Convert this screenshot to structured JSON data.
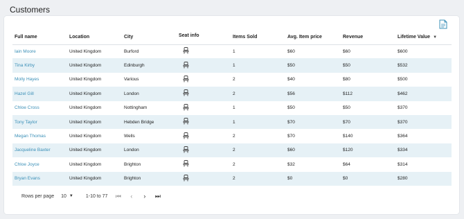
{
  "page": {
    "title": "Customers"
  },
  "icons": {
    "export": "document-export-icon",
    "seat": "seat-icon",
    "sort": "sort-desc-icon"
  },
  "colors": {
    "link": "#3a8fb7",
    "stripe": "#e6f1f6"
  },
  "table": {
    "columns": [
      "Full name",
      "Location",
      "City",
      "Seat info",
      "Items Sold",
      "Avg. Item price",
      "Revenue",
      "Lifetime Value"
    ],
    "sort": {
      "column": "Lifetime Value",
      "direction": "desc"
    },
    "rows": [
      {
        "name": "Iain Moore",
        "location": "United Kingdom",
        "city": "Burford",
        "items": "1",
        "avg": "$60",
        "revenue": "$60",
        "ltv": "$600"
      },
      {
        "name": "Tina Kirby",
        "location": "United Kingdom",
        "city": "Edinburgh",
        "items": "1",
        "avg": "$50",
        "revenue": "$50",
        "ltv": "$532"
      },
      {
        "name": "Molly Hayes",
        "location": "United Kingdom",
        "city": "Various",
        "items": "2",
        "avg": "$40",
        "revenue": "$80",
        "ltv": "$500"
      },
      {
        "name": "Hazel Gill",
        "location": "United Kingdom",
        "city": "London",
        "items": "2",
        "avg": "$56",
        "revenue": "$112",
        "ltv": "$462"
      },
      {
        "name": "Chloe Cross",
        "location": "United Kingdom",
        "city": "Nottingham",
        "items": "1",
        "avg": "$50",
        "revenue": "$50",
        "ltv": "$370"
      },
      {
        "name": "Tony Taylor",
        "location": "United Kingdom",
        "city": "Hebden Bridge",
        "items": "1",
        "avg": "$70",
        "revenue": "$70",
        "ltv": "$370"
      },
      {
        "name": "Megan Thomas",
        "location": "United Kingdom",
        "city": "Wells",
        "items": "2",
        "avg": "$70",
        "revenue": "$140",
        "ltv": "$364"
      },
      {
        "name": "Jacqueline Baxter",
        "location": "United Kingdom",
        "city": "London",
        "items": "2",
        "avg": "$60",
        "revenue": "$120",
        "ltv": "$334"
      },
      {
        "name": "Chloe Joyce",
        "location": "United Kingdom",
        "city": "Brighton",
        "items": "2",
        "avg": "$32",
        "revenue": "$64",
        "ltv": "$314"
      },
      {
        "name": "Bryan Evans",
        "location": "United Kingdom",
        "city": "Brighton",
        "items": "2",
        "avg": "$0",
        "revenue": "$0",
        "ltv": "$280"
      }
    ]
  },
  "pagination": {
    "rows_per_page_label": "Rows per page",
    "rows_per_page_value": "10",
    "range": "1-10 to 77",
    "first": "⏮",
    "prev": "‹",
    "next": "›",
    "last": "⏭"
  }
}
